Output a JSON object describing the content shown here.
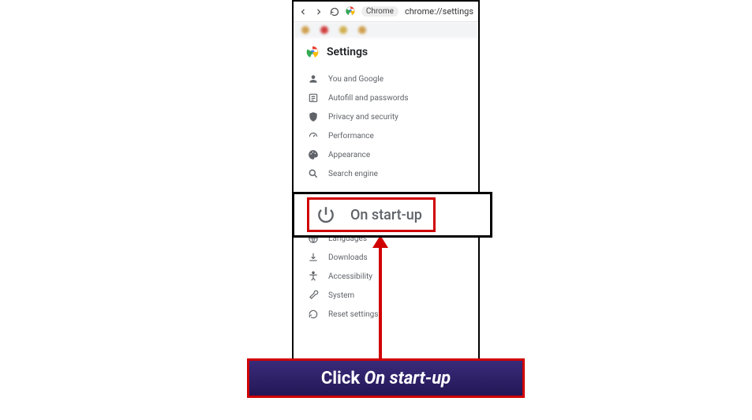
{
  "browser": {
    "label_chip": "Chrome",
    "url": "chrome://settings"
  },
  "settings": {
    "title": "Settings",
    "nav": [
      {
        "label": "You and Google"
      },
      {
        "label": "Autofill and passwords"
      },
      {
        "label": "Privacy and security"
      },
      {
        "label": "Performance"
      },
      {
        "label": "Appearance"
      },
      {
        "label": "Search engine"
      }
    ],
    "nav_after": [
      {
        "label": "Languages"
      },
      {
        "label": "Downloads"
      },
      {
        "label": "Accessibility"
      },
      {
        "label": "System"
      },
      {
        "label": "Reset settings"
      }
    ]
  },
  "highlight": {
    "label": "On start-up"
  },
  "caption": {
    "prefix": "Click ",
    "emphasis": "On start-up"
  }
}
